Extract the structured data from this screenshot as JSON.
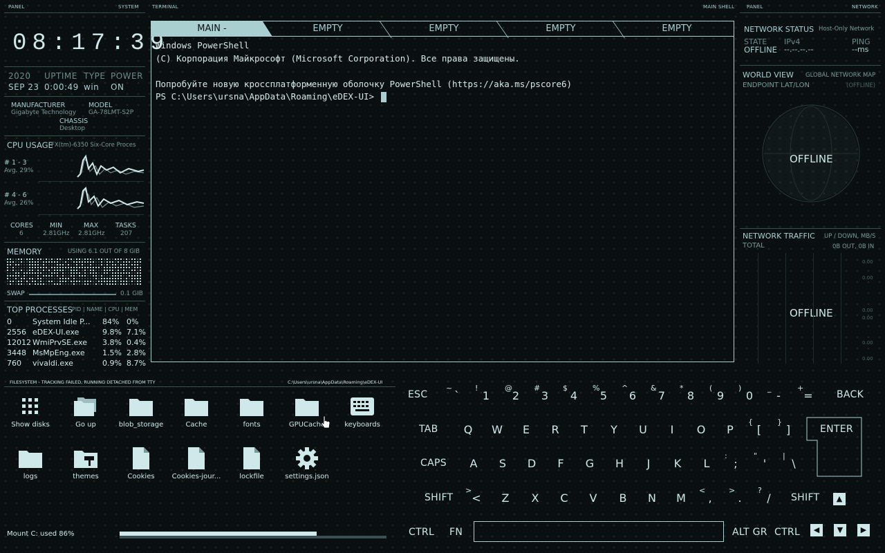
{
  "headers": {
    "left_panel": "PANEL",
    "left_system": "SYSTEM",
    "terminal": "TERMINAL",
    "main_shell": "MAIN SHELL",
    "right_panel": "PANEL",
    "right_network": "NETWORK"
  },
  "clock": "08:17:39",
  "sysinfo": {
    "year": "2020",
    "date": "SEP 23",
    "uptime_label": "UPTIME",
    "uptime": "0:00:49",
    "type_label": "TYPE",
    "type": "win",
    "power_label": "POWER",
    "power": "ON",
    "manufacturer_label": "MANUFACTURER",
    "manufacturer": "Gigabyte Technology",
    "model_label": "MODEL",
    "model": "GA-78LMT-S2P",
    "chassis_label": "CHASSIS",
    "chassis": "Desktop"
  },
  "cpu": {
    "title": "CPU USAGE",
    "model": "FX(tm)-6350 Six-Core Proces",
    "core1_label": "# 1 - 3",
    "core1_avg": "Avg. 29%",
    "core2_label": "# 4 - 6",
    "core2_avg": "Avg. 26%",
    "stats": [
      {
        "label": "CORES",
        "value": "6"
      },
      {
        "label": "MIN",
        "value": "2.81GHz"
      },
      {
        "label": "MAX",
        "value": "2.81GHz"
      },
      {
        "label": "TASKS",
        "value": "207"
      }
    ]
  },
  "memory": {
    "title": "MEMORY",
    "usage": "USING 6.1 OUT OF 8 GIB",
    "swap_label": "SWAP",
    "swap_value": "0.1 GIB"
  },
  "processes": {
    "title": "TOP PROCESSES",
    "columns": "PID | NAME | CPU | MEM",
    "rows": [
      {
        "pid": "0",
        "name": "System Idle P...",
        "cpu": "84%",
        "mem": "0%"
      },
      {
        "pid": "2556",
        "name": "eDEX-UI.exe",
        "cpu": "9.8%",
        "mem": "7.1%"
      },
      {
        "pid": "12012",
        "name": "WmiPrvSE.exe",
        "cpu": "3.8%",
        "mem": "0.4%"
      },
      {
        "pid": "3448",
        "name": "MsMpEng.exe",
        "cpu": "1.5%",
        "mem": "2.8%"
      },
      {
        "pid": "760",
        "name": "vivaldi.exe",
        "cpu": "0.9%",
        "mem": "8.7%"
      }
    ]
  },
  "terminal": {
    "tabs": [
      "MAIN -",
      "EMPTY",
      "EMPTY",
      "EMPTY",
      "EMPTY"
    ],
    "lines": [
      "Windows PowerShell",
      "(C) Корпорация Майкрософт (Microsoft Corporation). Все права защищены.",
      "",
      "Попробуйте новую кроссплатформенную оболочку PowerShell (https://aka.ms/pscore6)",
      "PS C:\\Users\\ursna\\AppData\\Roaming\\eDEX-UI> "
    ]
  },
  "network": {
    "status_title": "NETWORK STATUS",
    "interface": "Host-Only Network",
    "state_label": "STATE",
    "state": "OFFLINE",
    "ipv4_label": "IPv4",
    "ipv4": "--.--.--.--",
    "ping_label": "PING",
    "ping": "--ms",
    "world_title": "WORLD VIEW",
    "world_sub": "GLOBAL NETWORK MAP",
    "endpoint_label": "ENDPOINT LAT/LON",
    "endpoint_value": "(OFFLINE)",
    "globe_text": "OFFLINE",
    "traffic_title": "NETWORK TRAFFIC",
    "traffic_sub": "UP / DOWN, MB/S",
    "total_label": "TOTAL",
    "total_value": "0B OUT, 0B IN",
    "traffic_text": "OFFLINE",
    "traffic_scale": [
      "0.00",
      "0.00",
      "0.00",
      "0.00",
      "0.00",
      "0.00"
    ]
  },
  "filesystem": {
    "title": "FILESYSTEM - TRACKING FAILED, RUNNING DETACHED FROM TTY",
    "path": "C:\\Users\\ursna\\AppData\\Roaming\\eDEX-UI",
    "items": [
      {
        "label": "Show disks",
        "icon": "grid-icon"
      },
      {
        "label": "Go up",
        "icon": "folder-up-icon"
      },
      {
        "label": "blob_storage",
        "icon": "folder-icon"
      },
      {
        "label": "Cache",
        "icon": "folder-icon"
      },
      {
        "label": "fonts",
        "icon": "folder-icon"
      },
      {
        "label": "GPUCache",
        "icon": "folder-icon"
      },
      {
        "label": "keyboards",
        "icon": "keyboard-icon"
      },
      {
        "label": "logs",
        "icon": "folder-icon"
      },
      {
        "label": "themes",
        "icon": "themes-folder-icon"
      },
      {
        "label": "Cookies",
        "icon": "file-icon"
      },
      {
        "label": "Cookies-jour...",
        "icon": "file-icon"
      },
      {
        "label": "lockfile",
        "icon": "file-icon"
      },
      {
        "label": "settings.json",
        "icon": "gear-icon"
      }
    ],
    "mount_label": "Mount C: used 86%",
    "mount_used": 0.86
  },
  "keyboard": {
    "esc": "ESC",
    "back": "BACK",
    "tab": "TAB",
    "enter": "ENTER",
    "caps": "CAPS",
    "shift_l": "SHIFT",
    "shift_r": "SHIFT",
    "ctrl_l": "CTRL",
    "fn": "FN",
    "altgr": "ALT GR",
    "ctrl_r": "CTRL",
    "row1": [
      {
        "k": "`",
        "s": "~"
      },
      {
        "k": "1",
        "s": "!"
      },
      {
        "k": "2",
        "s": "@"
      },
      {
        "k": "3",
        "s": "#"
      },
      {
        "k": "4",
        "s": "$"
      },
      {
        "k": "5",
        "s": "%"
      },
      {
        "k": "6",
        "s": "^"
      },
      {
        "k": "7",
        "s": "&"
      },
      {
        "k": "8",
        "s": "*"
      },
      {
        "k": "9",
        "s": "("
      },
      {
        "k": "0",
        "s": ")"
      },
      {
        "k": "-",
        "s": "_"
      },
      {
        "k": "=",
        "s": "+"
      }
    ],
    "row2": [
      {
        "k": "Q",
        "s": ""
      },
      {
        "k": "W",
        "s": ""
      },
      {
        "k": "E",
        "s": ""
      },
      {
        "k": "R",
        "s": ""
      },
      {
        "k": "T",
        "s": ""
      },
      {
        "k": "Y",
        "s": ""
      },
      {
        "k": "U",
        "s": ""
      },
      {
        "k": "I",
        "s": ""
      },
      {
        "k": "O",
        "s": ""
      },
      {
        "k": "P",
        "s": ""
      },
      {
        "k": "[",
        "s": "{"
      },
      {
        "k": "]",
        "s": "}"
      }
    ],
    "row3": [
      {
        "k": "A",
        "s": ""
      },
      {
        "k": "S",
        "s": ""
      },
      {
        "k": "D",
        "s": ""
      },
      {
        "k": "F",
        "s": ""
      },
      {
        "k": "G",
        "s": ""
      },
      {
        "k": "H",
        "s": ""
      },
      {
        "k": "J",
        "s": ""
      },
      {
        "k": "K",
        "s": ""
      },
      {
        "k": "L",
        "s": ""
      },
      {
        "k": ";",
        "s": ":"
      },
      {
        "k": "'",
        "s": "\""
      },
      {
        "k": "\\",
        "s": "|"
      }
    ],
    "row4": [
      {
        "k": "<",
        "s": ">"
      },
      {
        "k": "Z",
        "s": ""
      },
      {
        "k": "X",
        "s": ""
      },
      {
        "k": "C",
        "s": ""
      },
      {
        "k": "V",
        "s": ""
      },
      {
        "k": "B",
        "s": ""
      },
      {
        "k": "N",
        "s": ""
      },
      {
        "k": "M",
        "s": ""
      },
      {
        "k": ",",
        "s": "<"
      },
      {
        "k": ".",
        "s": ">"
      },
      {
        "k": "/",
        "s": "?"
      }
    ]
  }
}
